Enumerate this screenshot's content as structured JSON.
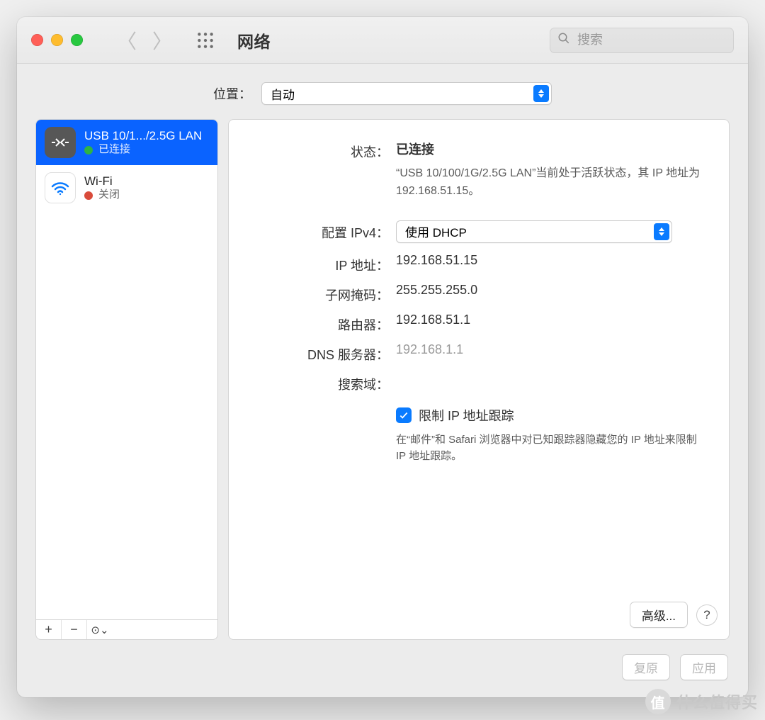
{
  "window": {
    "title": "网络"
  },
  "search": {
    "placeholder": "搜索"
  },
  "location": {
    "label": "位置：",
    "value": "自动"
  },
  "sidebar": {
    "items": [
      {
        "name": "USB 10/1.../2.5G LAN",
        "status_label": "已连接",
        "status": "green",
        "icon": "ethernet",
        "selected": true
      },
      {
        "name": "Wi-Fi",
        "status_label": "关闭",
        "status": "red",
        "icon": "wifi",
        "selected": false
      }
    ],
    "footer": {
      "add": "+",
      "remove": "−",
      "more": "⊙⌄"
    }
  },
  "details": {
    "status_label": "状态：",
    "status_value": "已连接",
    "status_desc": "“USB 10/100/1G/2.5G LAN”当前处于活跃状态，其 IP 地址为 192.168.51.15。",
    "config_ipv4_label": "配置 IPv4：",
    "config_ipv4_value": "使用 DHCP",
    "ip_label": "IP 地址：",
    "ip_value": "192.168.51.15",
    "subnet_label": "子网掩码：",
    "subnet_value": "255.255.255.0",
    "router_label": "路由器：",
    "router_value": "192.168.51.1",
    "dns_label": "DNS 服务器：",
    "dns_value": "192.168.1.1",
    "search_domain_label": "搜索域：",
    "limit_tracking_label": "限制 IP 地址跟踪",
    "limit_tracking_desc": "在“邮件”和 Safari 浏览器中对已知跟踪器隐藏您的 IP 地址来限制 IP 地址跟踪。",
    "advanced_btn": "高级...",
    "help_btn": "?"
  },
  "footer": {
    "revert": "复原",
    "apply": "应用"
  },
  "watermark": "什么值得买"
}
